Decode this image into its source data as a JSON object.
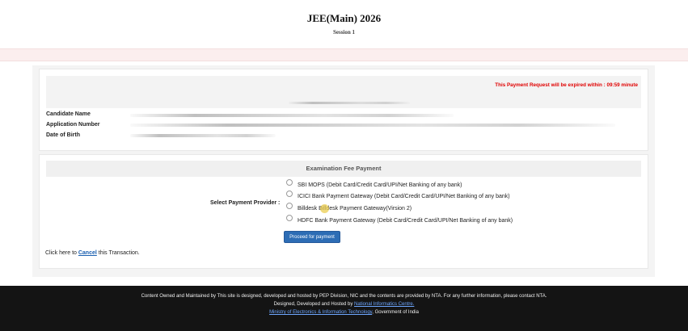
{
  "header": {
    "title": "JEE(Main) 2026",
    "subtitle": "Session 1"
  },
  "timer": {
    "text": "This Payment Request will be expired within : 09:59 minute"
  },
  "candidate": {
    "name_label": "Candidate Name",
    "application_label": "Application Number",
    "dob_label": "Date of Birth"
  },
  "payment": {
    "section_title": "Examination Fee Payment",
    "provider_label": "Select Payment Provider :",
    "options": [
      {
        "label": "SBI MOPS (Debit Card/Credit Card/UPI/Net Banking of any bank)",
        "selected": false
      },
      {
        "label": "ICICI Bank Payment Gateway (Debit Card/Credit Card/UPI/Net Banking of any bank)",
        "selected": false
      },
      {
        "label": "Billdesk Billdesk Payment Gateway(Virsion 2)",
        "selected": false
      },
      {
        "label": "HDFC Bank Payment Gateway (Debit Card/Credit Card/UPI/Net Banking of any bank)",
        "selected": false
      }
    ],
    "proceed_label": "Proceed for payment",
    "cancel_prefix": "Click here to",
    "cancel_link": "Cancel",
    "cancel_suffix": "this Transaction."
  },
  "footer": {
    "line1": "Content Owned and Maintained by This site is designed, developed and hosted by PEP Division, NIC and the contents are provided by NTA. For any further information, please contact NTA.",
    "line2_prefix": "Designed, Developed and Hosted by",
    "line2_link": "National Informatics Centre.",
    "line3_link": "Ministry of Electronics & Information Technology",
    "line3_suffix": ", Government of India"
  },
  "colors": {
    "timer": "#e00000",
    "button": "#2d6db5",
    "link": "#1a5fb0",
    "footer_bg": "#141414",
    "strip": "#fbeeee"
  }
}
